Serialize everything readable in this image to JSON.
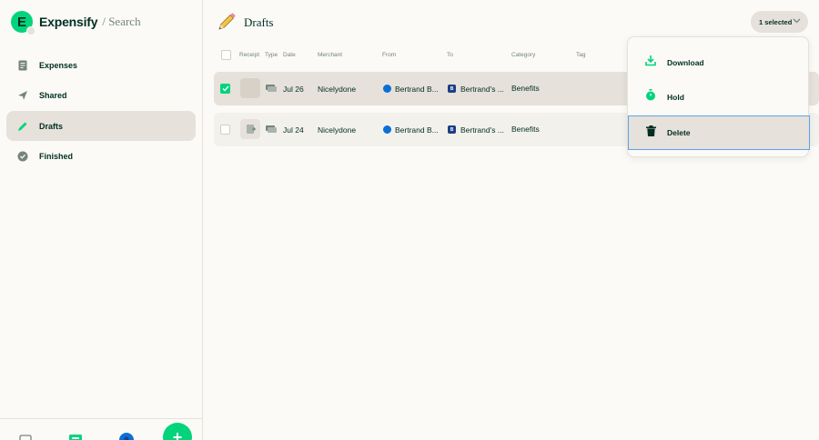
{
  "brand": {
    "name": "Expensify",
    "separator": "/ Search",
    "logo_letter": "E"
  },
  "sidebar": {
    "items": [
      {
        "label": "Expenses",
        "icon": "receipt-icon",
        "active": false
      },
      {
        "label": "Shared",
        "icon": "paper-plane-icon",
        "active": false
      },
      {
        "label": "Drafts",
        "icon": "pencil-icon",
        "active": true
      },
      {
        "label": "Finished",
        "icon": "check-circle-icon",
        "active": false
      }
    ]
  },
  "header": {
    "title": "Drafts",
    "selected_label": "1 selected"
  },
  "table": {
    "columns": [
      "Receipt",
      "Type",
      "Date",
      "Merchant",
      "From",
      "To",
      "Category",
      "Tag"
    ],
    "rows": [
      {
        "date": "Jul 26",
        "merchant": "Nicelydone",
        "from": "Bertrand B...",
        "to": "Bertrand's ...",
        "to_badge": "B",
        "category": "Benefits",
        "selected": true
      },
      {
        "date": "Jul 24",
        "merchant": "Nicelydone",
        "from": "Bertrand B...",
        "to": "Bertrand's ...",
        "to_badge": "B",
        "category": "Benefits",
        "selected": false
      }
    ]
  },
  "menu": {
    "items": [
      {
        "label": "Download",
        "icon": "download-icon"
      },
      {
        "label": "Hold",
        "icon": "stopwatch-icon"
      },
      {
        "label": "Delete",
        "icon": "trash-icon"
      }
    ]
  },
  "colors": {
    "accent": "#03d47c",
    "text": "#002e22",
    "muted": "#76847e",
    "hover": "#e6e1da",
    "focus": "#5ea3e6"
  }
}
